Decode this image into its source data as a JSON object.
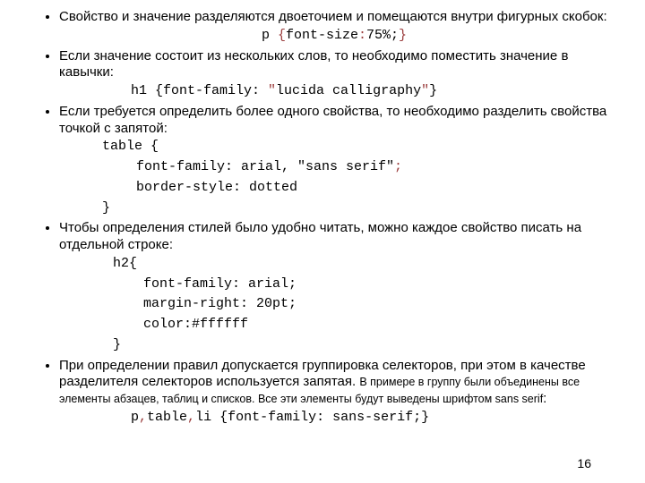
{
  "bullets": {
    "b1_text": "Свойство и значение разделяются двоеточием и помещаются внутри фигурных скобок:",
    "b1_code_a": "p ",
    "b1_code_b": "{",
    "b1_code_c": "font-size",
    "b1_code_d": ":",
    "b1_code_e": "75%;",
    "b1_code_f": "}",
    "b2_text": "Если значение состоит из нескольких слов, то необходимо поместить значение в кавычки:",
    "b2_code_a": "h1 {font-family: ",
    "b2_code_b": "\"",
    "b2_code_c": "lucida calligraphy",
    "b2_code_d": "\"",
    "b2_code_e": "}",
    "b3_text": "Если требуется определить более одного свойства, то необходимо разделить свойства точкой с запятой:",
    "b3_l1": "table {",
    "b3_l2a": "font-family: arial, \"sans serif\"",
    "b3_l2b": ";",
    "b3_l3": "border-style: dotted",
    "b3_l4": "}",
    "b4_text": "Чтобы определения стилей было удобно читать, можно каждое свойство писать на отдельной строке:",
    "b4_l1": "h2{",
    "b4_l2": "font-family: arial;",
    "b4_l3": "margin-right: 20pt;",
    "b4_l4": "color:#ffffff",
    "b4_l5": "}",
    "b5_text_a": "При определении правил допускается группировка селекторов, при этом в качестве разделителя селекторов используется запятая. ",
    "b5_text_b": "В примере в группу были объединены все элементы абзацев, таблиц и списков. Все эти элементы будут выведены шрифтом sans serif",
    "b5_text_c": ":",
    "b5_code_a": "p",
    "b5_code_b": ",",
    "b5_code_c": "table",
    "b5_code_d": ",",
    "b5_code_e": "li {font-family: sans-serif;}"
  },
  "page_number": "16"
}
